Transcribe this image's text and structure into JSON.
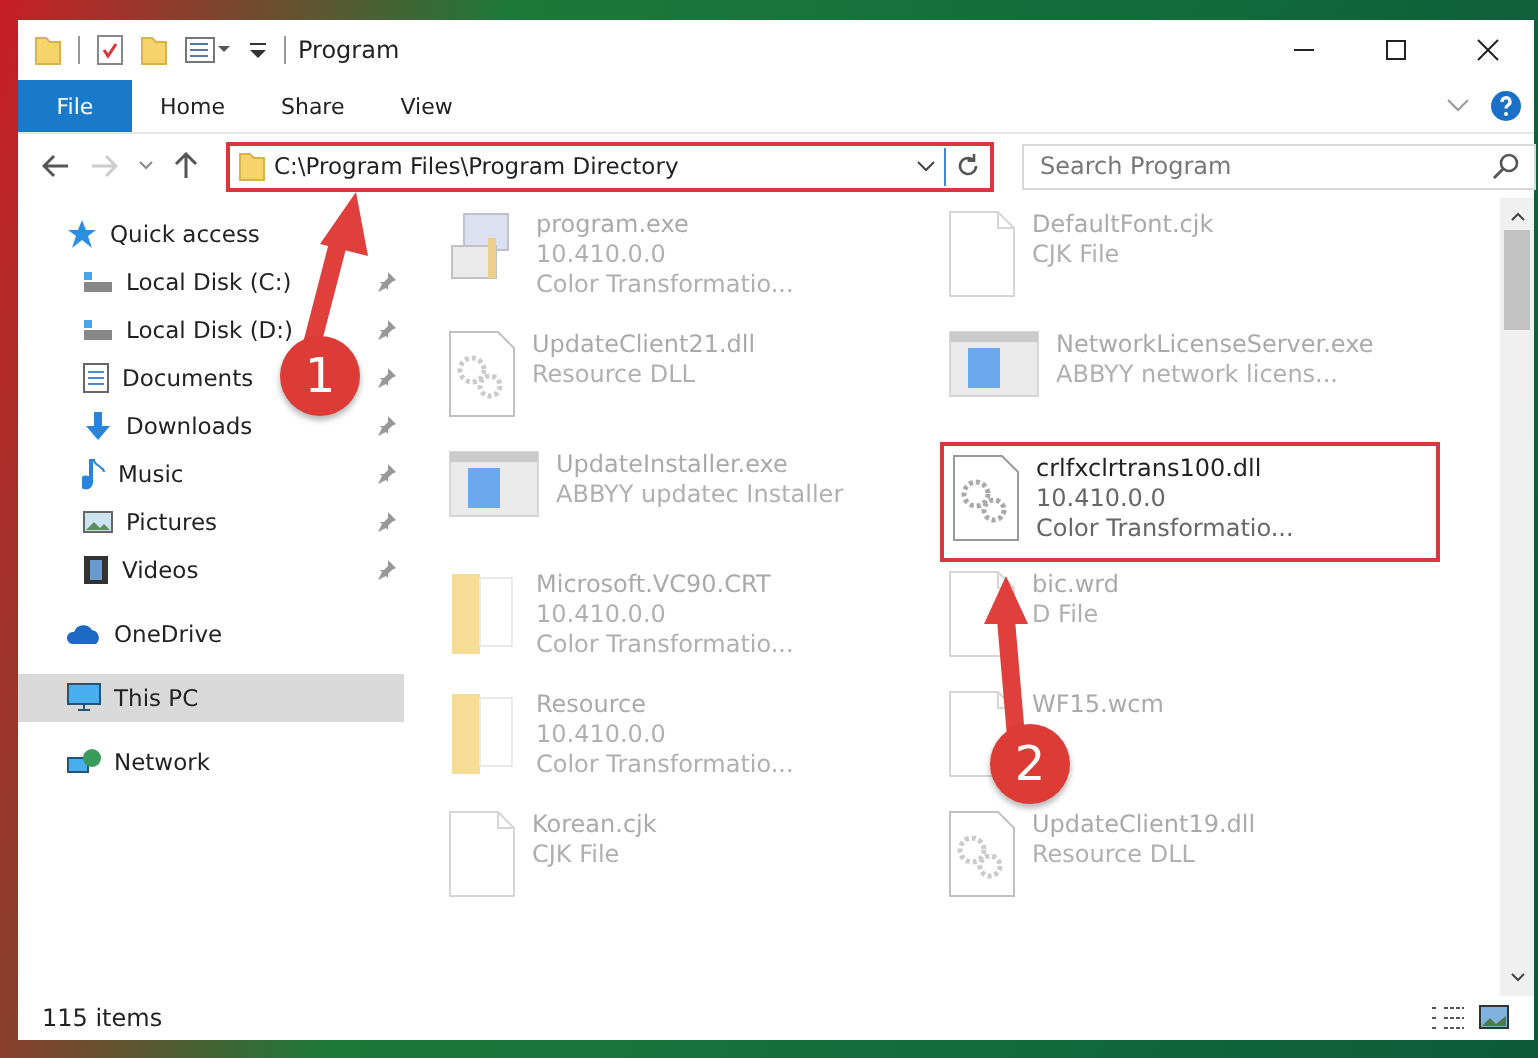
{
  "window": {
    "title": "Program"
  },
  "ribbon_tabs": [
    {
      "label": "File",
      "kind": "menu"
    },
    {
      "label": "Home",
      "kind": "tab"
    },
    {
      "label": "Share",
      "kind": "tab"
    },
    {
      "label": "View",
      "kind": "tab"
    }
  ],
  "address": {
    "path": "C:\\Program Files\\Program Directory",
    "highlighted": true
  },
  "search": {
    "placeholder": "Search Program"
  },
  "sidebar": {
    "items": [
      {
        "label": "Quick access",
        "kind": "star",
        "selected": false,
        "children": [
          {
            "label": "Local Disk (C:)",
            "kind": "disk",
            "pinned": true
          },
          {
            "label": "Local Disk (D:)",
            "kind": "disk",
            "pinned": true
          },
          {
            "label": "Documents",
            "kind": "documents",
            "pinned": true
          },
          {
            "label": "Downloads",
            "kind": "downloads",
            "pinned": true
          },
          {
            "label": "Music",
            "kind": "music",
            "pinned": true
          },
          {
            "label": "Pictures",
            "kind": "pictures",
            "pinned": true
          },
          {
            "label": "Videos",
            "kind": "videos",
            "pinned": true
          }
        ]
      },
      {
        "label": "OneDrive",
        "kind": "cloud",
        "selected": false
      },
      {
        "label": "This PC",
        "kind": "pc",
        "selected": true
      },
      {
        "label": "Network",
        "kind": "network",
        "selected": false
      }
    ]
  },
  "files": [
    {
      "name": "program.exe",
      "details": [
        "10.410.0.0",
        "Color Transformatio..."
      ],
      "kind": "exe",
      "selected": false
    },
    {
      "name": "DefaultFont.cjk",
      "details": [
        "CJK File"
      ],
      "kind": "file",
      "selected": false
    },
    {
      "name": "UpdateClient21.dll",
      "details": [
        "Resource DLL"
      ],
      "kind": "dll",
      "selected": false
    },
    {
      "name": "NetworkLicenseServer.exe",
      "details": [
        "ABBYY network licens..."
      ],
      "kind": "app",
      "selected": false
    },
    {
      "name": "UpdateInstaller.exe",
      "details": [
        "ABBYY updatec Installer"
      ],
      "kind": "app",
      "selected": false
    },
    {
      "name": "crlfxclrtrans100.dll",
      "details": [
        "10.410.0.0",
        "Color Transformatio..."
      ],
      "kind": "gears",
      "selected": true
    },
    {
      "name": "Microsoft.VC90.CRT",
      "details": [
        "10.410.0.0",
        "Color Transformatio..."
      ],
      "kind": "folder",
      "selected": false
    },
    {
      "name": "bic.wrd",
      "details": [
        "D File"
      ],
      "kind": "file",
      "selected": false
    },
    {
      "name": "Resource",
      "details": [
        "10.410.0.0",
        "Color Transformatio..."
      ],
      "kind": "folder",
      "selected": false
    },
    {
      "name": "WF15.wcm",
      "kind": "file",
      "selected": false
    },
    {
      "name": "Korean.cjk",
      "details": [
        "CJK File"
      ],
      "kind": "file",
      "selected": false
    },
    {
      "name": "UpdateClient19.dll",
      "details": [
        "Resource DLL"
      ],
      "kind": "dll",
      "selected": false
    }
  ],
  "status_bar": {
    "count": "115 items"
  },
  "annotations": [
    {
      "number": "1"
    },
    {
      "number": "2"
    }
  ]
}
